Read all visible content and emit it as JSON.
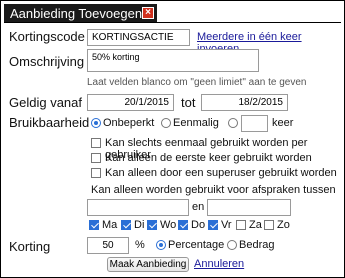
{
  "dialog": {
    "title": "Aanbieding Toevoegen",
    "close_glyph": "×"
  },
  "code": {
    "label": "Kortingscode",
    "value": "KORTINGSACTIE",
    "more_link": "Meerdere in één keer invoeren"
  },
  "description": {
    "label": "Omschrijving",
    "value": "50% korting",
    "hint": "Laat velden blanco om \"geen limiet\" aan te geven"
  },
  "validity": {
    "label": "Geldig vanaf",
    "from": "20/1/2015",
    "to_label": "tot",
    "to": "18/2/2015"
  },
  "usage": {
    "label": "Bruikbaarheid",
    "options": [
      "Onbeperkt",
      "Eenmalig"
    ],
    "selected": "Onbeperkt",
    "times_value": "",
    "times_suffix": "keer",
    "checks": [
      {
        "label": "Kan slechts eenmaal gebruikt worden per gebruiker",
        "checked": false
      },
      {
        "label": "Kan alleen de eerste keer gebruikt worden",
        "checked": false
      },
      {
        "label": "Kan alleen door een superuser gebruikt worden",
        "checked": false
      }
    ]
  },
  "appointments": {
    "label": "Kan alleen worden gebruikt voor afspraken tussen",
    "between_from": "",
    "and_label": "en",
    "between_to": "",
    "days": [
      {
        "label": "Ma",
        "checked": true
      },
      {
        "label": "Di",
        "checked": true
      },
      {
        "label": "Wo",
        "checked": true
      },
      {
        "label": "Do",
        "checked": true
      },
      {
        "label": "Vr",
        "checked": true
      },
      {
        "label": "Za",
        "checked": false
      },
      {
        "label": "Zo",
        "checked": false
      }
    ]
  },
  "discount": {
    "label": "Korting",
    "value": "50",
    "percent_sign": "%",
    "options": [
      "Percentage",
      "Bedrag"
    ],
    "selected": "Percentage"
  },
  "actions": {
    "submit_label": "Maak Aanbieding",
    "cancel_label": "Annuleren"
  },
  "colors": {
    "accent": "#2a6fd6",
    "close": "#d0301d",
    "titlebar": "#1a1a1a"
  }
}
